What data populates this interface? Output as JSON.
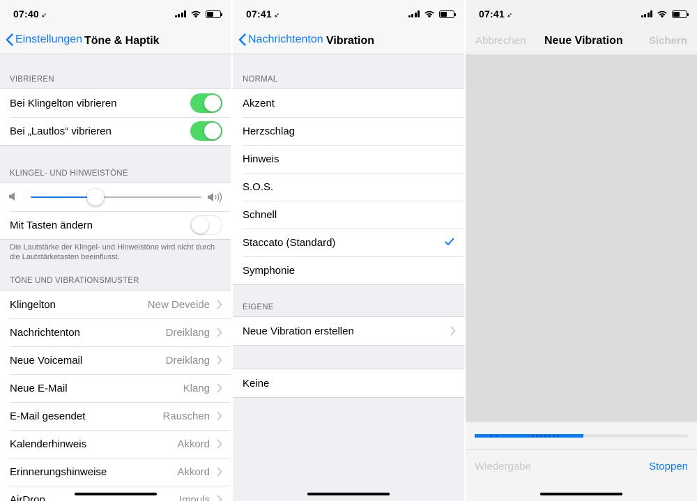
{
  "panel1": {
    "status": {
      "time": "07:40",
      "loc": "➶"
    },
    "nav": {
      "back_label": "Einstellungen",
      "title": "Töne & Haptik"
    },
    "vibrate_section": {
      "header": "VIBRIEREN",
      "rows": [
        {
          "label": "Bei Klingelton vibrieren",
          "on": true
        },
        {
          "label": "Bei „Lautlos“ vibrieren",
          "on": true
        }
      ]
    },
    "ringer_section": {
      "header": "KLINGEL- UND HINWEISTÖNE",
      "volume": 0.38,
      "change_with_buttons": {
        "label": "Mit Tasten ändern",
        "on": false
      },
      "footer": "Die Lautstärke der Klingel- und Hinweistöne wird nicht durch die Lautstärketasten beeinflusst."
    },
    "sounds_section": {
      "header": "TÖNE UND VIBRATIONSMUSTER",
      "rows": [
        {
          "label": "Klingelton",
          "value": "New Deveide"
        },
        {
          "label": "Nachrichtenton",
          "value": "Dreiklang"
        },
        {
          "label": "Neue Voicemail",
          "value": "Dreiklang"
        },
        {
          "label": "Neue E-Mail",
          "value": "Klang"
        },
        {
          "label": "E-Mail gesendet",
          "value": "Rauschen"
        },
        {
          "label": "Kalenderhinweis",
          "value": "Akkord"
        },
        {
          "label": "Erinnerungshinweise",
          "value": "Akkord"
        },
        {
          "label": "AirDrop",
          "value": "Impuls"
        }
      ]
    }
  },
  "panel2": {
    "status": {
      "time": "07:41",
      "loc": "➶"
    },
    "nav": {
      "back_label": "Nachrichtenton",
      "title": "Vibration"
    },
    "normal_section": {
      "header": "NORMAL",
      "rows": [
        {
          "label": "Akzent"
        },
        {
          "label": "Herzschlag"
        },
        {
          "label": "Hinweis"
        },
        {
          "label": "S.O.S."
        },
        {
          "label": "Schnell"
        },
        {
          "label": "Staccato (Standard)",
          "selected": true
        },
        {
          "label": "Symphonie"
        }
      ]
    },
    "custom_section": {
      "header": "EIGENE",
      "create_label": "Neue Vibration erstellen"
    },
    "none_label": "Keine"
  },
  "panel3": {
    "status": {
      "time": "07:41",
      "loc": "➶"
    },
    "nav": {
      "cancel_label": "Abbrechen",
      "title": "Neue Vibration",
      "save_label": "Sichern"
    },
    "progress": 0.51,
    "playback_label": "Wiedergabe",
    "stop_label": "Stoppen"
  },
  "colors": {
    "accent": "#0a7aff",
    "toggle_on": "#4cd964",
    "group_bg": "#efeff4",
    "secondary_text": "#8e8e93"
  }
}
